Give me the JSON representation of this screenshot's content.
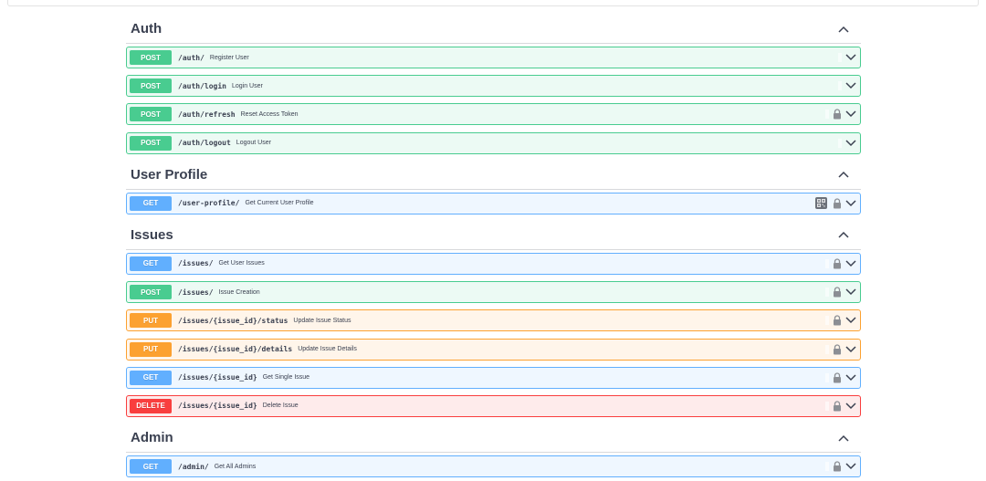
{
  "sections": [
    {
      "title": "Auth",
      "ops": [
        {
          "method": "POST",
          "path": "/auth/",
          "summary": "Register User",
          "locked": false
        },
        {
          "method": "POST",
          "path": "/auth/login",
          "summary": "Login User",
          "locked": false
        },
        {
          "method": "POST",
          "path": "/auth/refresh",
          "summary": "Reset Access Token",
          "locked": true
        },
        {
          "method": "POST",
          "path": "/auth/logout",
          "summary": "Logout User",
          "locked": false
        }
      ]
    },
    {
      "title": "User Profile",
      "ops": [
        {
          "method": "GET",
          "path": "/user-profile/",
          "summary": "Get Current User Profile",
          "locked": true
        }
      ]
    },
    {
      "title": "Issues",
      "ops": [
        {
          "method": "GET",
          "path": "/issues/",
          "summary": "Get User Issues",
          "locked": true
        },
        {
          "method": "POST",
          "path": "/issues/",
          "summary": "Issue Creation",
          "locked": true
        },
        {
          "method": "PUT",
          "path": "/issues/{issue_id}/status",
          "summary": "Update Issue Status",
          "locked": true
        },
        {
          "method": "PUT",
          "path": "/issues/{issue_id}/details",
          "summary": "Update Issue Details",
          "locked": true
        },
        {
          "method": "GET",
          "path": "/issues/{issue_id}",
          "summary": "Get Single Issue",
          "locked": true
        },
        {
          "method": "DELETE",
          "path": "/issues/{issue_id}",
          "summary": "Delete Issue",
          "locked": true
        }
      ]
    },
    {
      "title": "Admin",
      "ops": [
        {
          "method": "GET",
          "path": "/admin/",
          "summary": "Get All Admins",
          "locked": true
        }
      ]
    }
  ],
  "colors": {
    "post": "#49cc90",
    "get": "#61affe",
    "put": "#fca130",
    "delete": "#f93e3e",
    "text": "#3b4151"
  },
  "icons": {
    "section_toggle": "chevron-up-icon",
    "op_expand": "chevron-down-icon",
    "auth": "lock-icon",
    "browser_extension": "qr-code-icon"
  }
}
